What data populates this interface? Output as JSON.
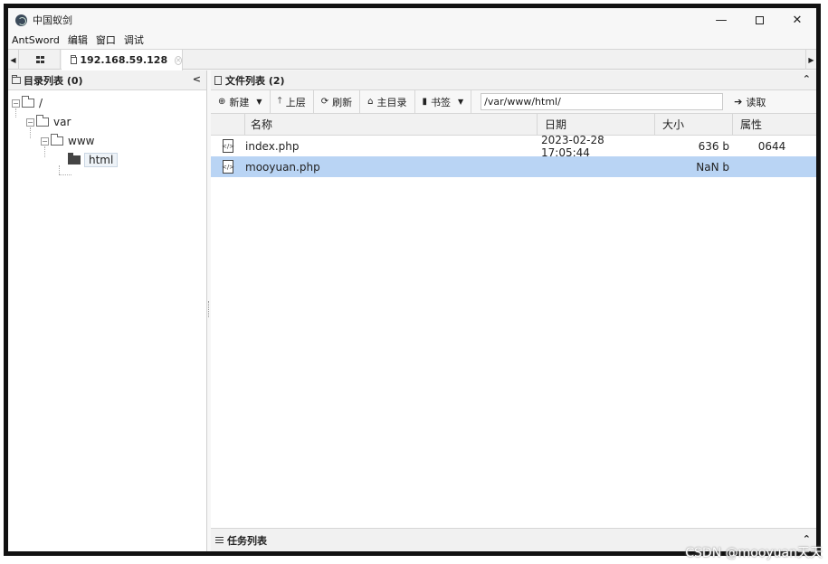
{
  "window": {
    "title": "中国蚁剑",
    "minimize": "—",
    "close": "✕"
  },
  "menu": [
    "AntSword",
    "编辑",
    "窗口",
    "调试"
  ],
  "tabs": {
    "host": "192.168.59.128"
  },
  "left_panel": {
    "title": "目录列表 (0)",
    "tree": [
      {
        "label": "/",
        "level": 0
      },
      {
        "label": "var",
        "level": 1
      },
      {
        "label": "www",
        "level": 2
      },
      {
        "label": "html",
        "level": 3,
        "selected": true
      }
    ]
  },
  "right_panel": {
    "title": "文件列表 (2)",
    "toolbar": {
      "new": "新建",
      "up": "上层",
      "refresh": "刷新",
      "home": "主目录",
      "bookmark": "书签",
      "path": "/var/www/html/",
      "read": "读取"
    },
    "columns": {
      "name": "名称",
      "date": "日期",
      "size": "大小",
      "attr": "属性"
    },
    "files": [
      {
        "name": "index.php",
        "date": "2023-02-28 17:05:44",
        "size": "636 b",
        "attr": "0644",
        "selected": false
      },
      {
        "name": "mooyuan.php",
        "date": "",
        "size": "NaN b",
        "attr": "",
        "selected": true
      }
    ]
  },
  "task_panel": {
    "title": "任务列表"
  },
  "watermark": "CSDN @mooyuan天天",
  "colors": {
    "selected_row": "#b9d4f4",
    "border": "#111111"
  }
}
